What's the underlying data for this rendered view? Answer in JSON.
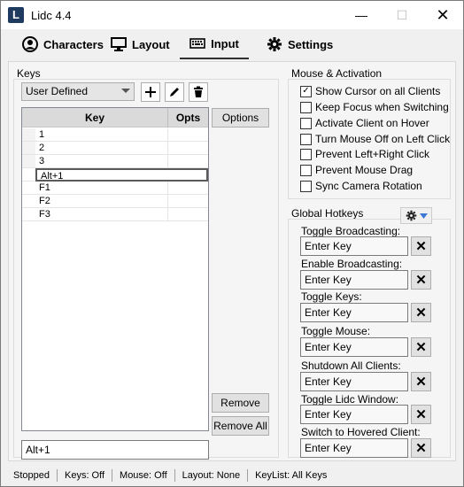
{
  "window": {
    "title": "Lidc 4.4",
    "icon_letter": "L"
  },
  "tabs": [
    {
      "label": "Characters",
      "icon": "user-circle-icon"
    },
    {
      "label": "Layout",
      "icon": "monitor-icon"
    },
    {
      "label": "Input",
      "icon": "keyboard-icon",
      "active": true
    },
    {
      "label": "Settings",
      "icon": "gear-icon"
    }
  ],
  "keys": {
    "group_label": "Keys",
    "profile_select": "User Defined",
    "columns": {
      "key": "Key",
      "opts": "Opts"
    },
    "rows": [
      {
        "key": "1",
        "opts": ""
      },
      {
        "key": "2",
        "opts": ""
      },
      {
        "key": "3",
        "opts": ""
      },
      {
        "key": "Alt+1",
        "opts": "",
        "selected": true
      },
      {
        "key": "F1",
        "opts": ""
      },
      {
        "key": "F2",
        "opts": ""
      },
      {
        "key": "F3",
        "opts": ""
      }
    ],
    "options_button": "Options",
    "remove_button": "Remove",
    "remove_all_button": "Remove All",
    "key_input_value": "Alt+1"
  },
  "mouse": {
    "group_label": "Mouse & Activation",
    "options": [
      {
        "label": "Show Cursor on all Clients",
        "checked": true
      },
      {
        "label": "Keep Focus when Switching",
        "checked": false
      },
      {
        "label": "Activate Client on Hover",
        "checked": false
      },
      {
        "label": "Turn Mouse Off on Left Click",
        "checked": false
      },
      {
        "label": "Prevent Left+Right Click",
        "checked": false
      },
      {
        "label": "Prevent Mouse Drag",
        "checked": false
      },
      {
        "label": "Sync Camera Rotation",
        "checked": false
      }
    ]
  },
  "hotkeys": {
    "group_label": "Global Hotkeys",
    "items": [
      {
        "label": "Toggle Broadcasting:",
        "value": "Enter Key"
      },
      {
        "label": "Enable Broadcasting:",
        "value": "Enter Key"
      },
      {
        "label": "Toggle Keys:",
        "value": "Enter Key"
      },
      {
        "label": "Toggle Mouse:",
        "value": "Enter Key"
      },
      {
        "label": "Shutdown All Clients:",
        "value": "Enter Key"
      },
      {
        "label": "Toggle Lidc Window:",
        "value": "Enter Key"
      },
      {
        "label": "Switch to Hovered Client:",
        "value": "Enter Key"
      }
    ]
  },
  "status": {
    "state": "Stopped",
    "keys": "Keys: Off",
    "mouse": "Mouse: Off",
    "layout": "Layout: None",
    "keylist": "KeyList: All Keys"
  }
}
